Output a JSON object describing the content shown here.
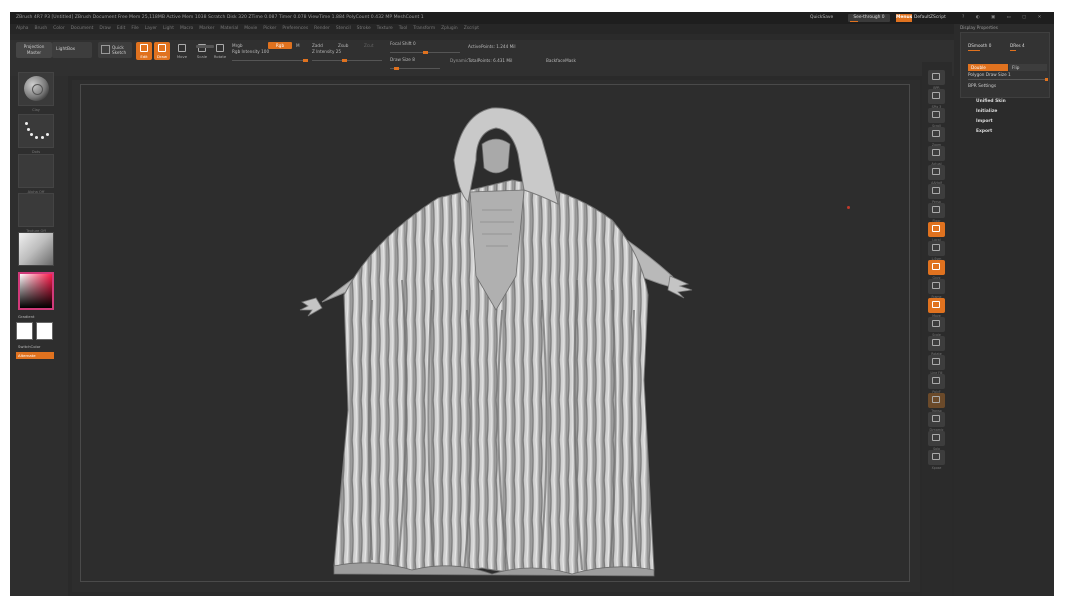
{
  "window": {
    "title": "ZBrush 4R7 P3 [Untitled]  ZBrush Document  Free Mem 25,118MB  Active Mem 1038  Scratch Disk 320  ZTime 0.087  Timer 0.078  ViewTime 1.884  PolyCount 0.432 MP  MeshCount 1",
    "quicksave": "QuickSave",
    "see_through": "See-through  0",
    "menus": "Menus",
    "default_script": "DefaultZScript",
    "window_icons": "?  ◐  ▣  ▭  ▢  ✕"
  },
  "menubar": [
    "Alpha",
    "Brush",
    "Color",
    "Document",
    "Draw",
    "Edit",
    "File",
    "Layer",
    "Light",
    "Macro",
    "Marker",
    "Material",
    "Movie",
    "Picker",
    "Preferences",
    "Render",
    "Stencil",
    "Stroke",
    "Texture",
    "Tool",
    "Transform",
    "Zplugin",
    "Zscript"
  ],
  "shelf": {
    "projection_master": "Projection Master",
    "lightbox": "LightBox",
    "quick_sketch": "Quick Sketch",
    "modes": [
      {
        "label": "Edit",
        "active": true
      },
      {
        "label": "Draw",
        "active": true
      },
      {
        "label": "Move",
        "active": false
      },
      {
        "label": "Scale",
        "active": false
      },
      {
        "label": "Rotate",
        "active": false
      }
    ],
    "mrgb": "Mrgb",
    "rgb": "Rgb",
    "m": "M",
    "zadd": "Zadd",
    "zsub": "Zsub",
    "zcut": "Zcut",
    "rgb_intensity": "Rgb Intensity 100",
    "z_intensity": "Z Intensity 25",
    "focal_shift": "Focal Shift 0",
    "draw_size": "Draw Size 8",
    "dynamic": "Dynamic",
    "active_points": "ActivePoints: 1.244 Mil",
    "total_points": "TotalPoints: 6.431 Mil",
    "backface": "BackfaceMask"
  },
  "lefttray": {
    "brush": "Clay",
    "stroke": "Dots",
    "alpha": "Alpha Off",
    "texture": "Texture Off",
    "material": "",
    "gradient": "Gradient",
    "switch_color": "SwitchColor",
    "alternate": "Alternate"
  },
  "rightshelf": [
    "BPR",
    "SPix 3",
    "Scroll",
    "Zoom",
    "Actual",
    "AAHalf",
    "Persp",
    "Floor",
    "Local",
    "L.Sym",
    "Gxyz",
    "Frame",
    "Move",
    "Scale",
    "Rotate",
    "Line Fill",
    "PolyF",
    "Transp",
    "Dynamic",
    "Solo",
    "Xpose"
  ],
  "rightpanel": {
    "header": "Display Properties",
    "smooth": "DSmooth 0",
    "dres": "DRes 4",
    "double": "Double",
    "flip": "Flip",
    "polygon_draw_size": "Polygon Draw Size 1",
    "bpr_settings": "BPR Settings",
    "items": [
      "Unified Skin",
      "Initialize",
      "Import",
      "Export"
    ]
  },
  "colors": {
    "accent": "#e0721f",
    "background": "#2a2a2a",
    "canvas": "#2d2d2d"
  }
}
